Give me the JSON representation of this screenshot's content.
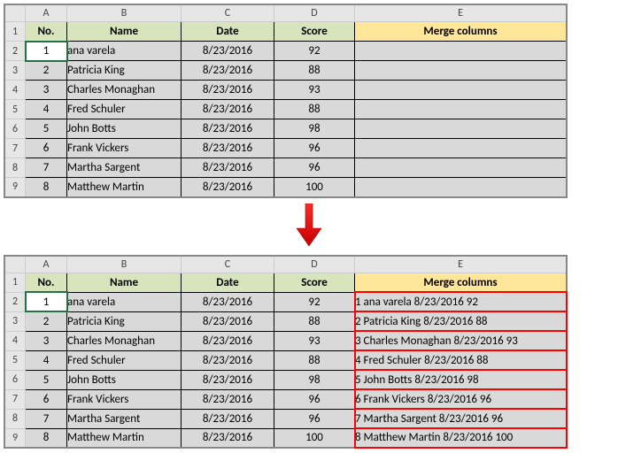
{
  "columns": [
    "A",
    "B",
    "C",
    "D",
    "E"
  ],
  "rows_top": [
    "1",
    "2",
    "3",
    "4",
    "5",
    "6",
    "7",
    "8",
    "9"
  ],
  "rows_bottom": [
    "1",
    "2",
    "3",
    "4",
    "5",
    "6",
    "7",
    "8",
    "9"
  ],
  "headers": {
    "no": "No.",
    "name": "Name",
    "date": "Date",
    "score": "Score",
    "merge": "Merge columns"
  },
  "top": [
    {
      "no": "1",
      "name": "ana varela",
      "date": "8/23/2016",
      "score": "92",
      "merge": ""
    },
    {
      "no": "2",
      "name": "Patricia King",
      "date": "8/23/2016",
      "score": "88",
      "merge": ""
    },
    {
      "no": "3",
      "name": "Charles Monaghan",
      "date": "8/23/2016",
      "score": "93",
      "merge": ""
    },
    {
      "no": "4",
      "name": "Fred Schuler",
      "date": "8/23/2016",
      "score": "88",
      "merge": ""
    },
    {
      "no": "5",
      "name": "John Botts",
      "date": "8/23/2016",
      "score": "98",
      "merge": ""
    },
    {
      "no": "6",
      "name": "Frank Vickers",
      "date": "8/23/2016",
      "score": "96",
      "merge": ""
    },
    {
      "no": "7",
      "name": "Martha Sargent",
      "date": "8/23/2016",
      "score": "96",
      "merge": ""
    },
    {
      "no": "8",
      "name": "Matthew Martin",
      "date": "8/23/2016",
      "score": "100",
      "merge": ""
    }
  ],
  "bottom": [
    {
      "no": "1",
      "name": "ana varela",
      "date": "8/23/2016",
      "score": "92",
      "merge": "1 ana varela 8/23/2016 92"
    },
    {
      "no": "2",
      "name": "Patricia King",
      "date": "8/23/2016",
      "score": "88",
      "merge": "2 Patricia King 8/23/2016 88"
    },
    {
      "no": "3",
      "name": "Charles Monaghan",
      "date": "8/23/2016",
      "score": "93",
      "merge": "3 Charles Monaghan 8/23/2016 93"
    },
    {
      "no": "4",
      "name": "Fred Schuler",
      "date": "8/23/2016",
      "score": "88",
      "merge": "4 Fred Schuler 8/23/2016 88"
    },
    {
      "no": "5",
      "name": "John Botts",
      "date": "8/23/2016",
      "score": "98",
      "merge": "5 John Botts 8/23/2016 98"
    },
    {
      "no": "6",
      "name": "Frank Vickers",
      "date": "8/23/2016",
      "score": "96",
      "merge": "6 Frank Vickers 8/23/2016 96"
    },
    {
      "no": "7",
      "name": "Martha Sargent",
      "date": "8/23/2016",
      "score": "96",
      "merge": "7 Martha Sargent 8/23/2016 96"
    },
    {
      "no": "8",
      "name": "Matthew Martin",
      "date": "8/23/2016",
      "score": "100",
      "merge": "8 Matthew Martin 8/23/2016 100"
    }
  ]
}
